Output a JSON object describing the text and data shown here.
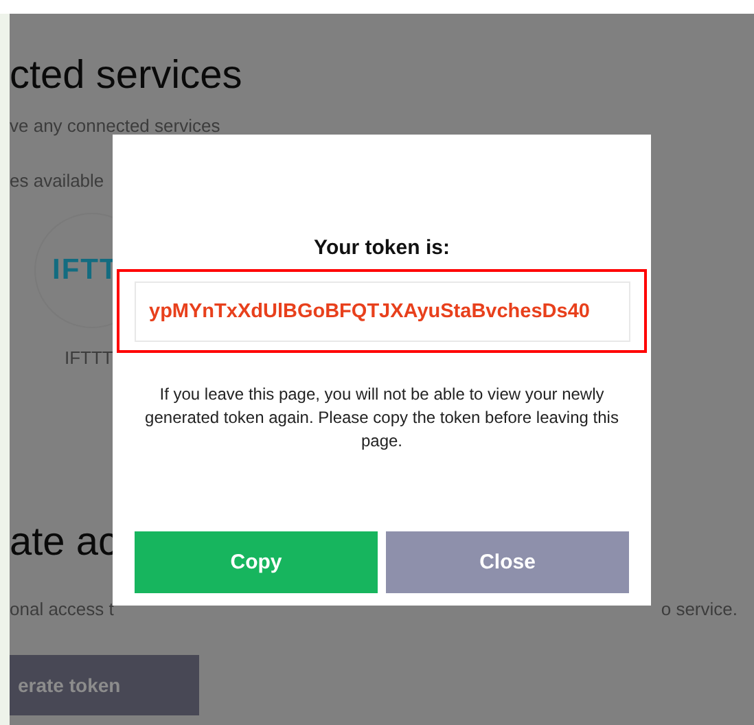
{
  "page": {
    "heading": "cted services",
    "subtitle": "ve any connected services",
    "available_label": "es available",
    "service": {
      "logo_text": "IFTT",
      "label": "IFTTT"
    },
    "section_heading": "ate ac",
    "section_text_start": "onal access t",
    "section_text_end": "o service.",
    "generate_button": "erate token"
  },
  "dialog": {
    "title": "Your token is:",
    "token": "ypMYnTxXdUlBGoBFQTJXAyuStaBvchesDs40",
    "message": "If you leave this page, you will not be able to view your newly generated token again. Please copy the token before leaving this page.",
    "buttons": [
      {
        "label": "Copy",
        "kind": "primary"
      },
      {
        "label": "Close",
        "kind": "secondary"
      }
    ]
  }
}
